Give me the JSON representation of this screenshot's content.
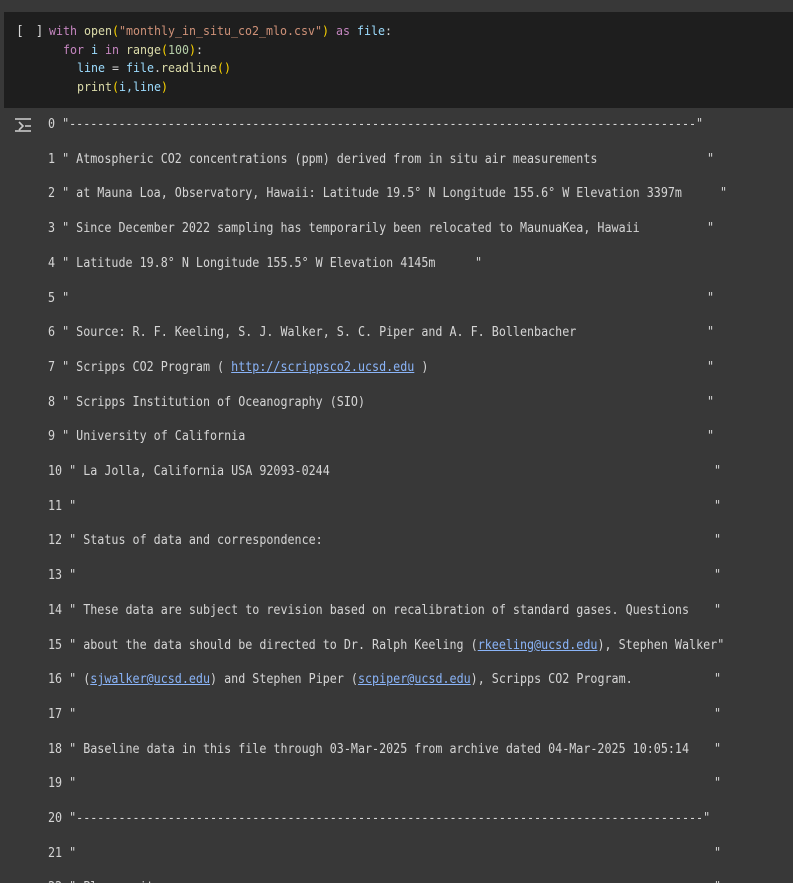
{
  "cell": {
    "run_label": "[ ]",
    "code": {
      "l1_kw1": "with",
      "l1_fn": "open",
      "l1_str": "\"monthly_in_situ_co2_mlo.csv\"",
      "l1_kw2": "as",
      "l1_var": "file",
      "l2_kw1": "for",
      "l2_var": "i",
      "l2_kw2": "in",
      "l2_fn": "range",
      "l2_num": "100",
      "l3_var1": "line",
      "l3_var2": "file",
      "l3_fn": "readline",
      "l4_fn": "print",
      "l4_args": "i,line"
    }
  },
  "output": {
    "icon": "output-toggle-icon",
    "lines": [
      {
        "n": "0",
        "text": "\"-----------------------------------------------------------------------------------------\""
      },
      {
        "n": "1",
        "text": "\" Atmospheric CO2 concentrations (ppm) derived from in situ air measurements",
        "end": "\""
      },
      {
        "n": "2",
        "text": "\" at Mauna Loa, Observatory, Hawaii: Latitude 19.5° N Longitude 155.6° W Elevation 3397m",
        "end": "\""
      },
      {
        "n": "3",
        "text": "\" Since December 2022 sampling has temporarily been relocated to MaunuaKea, Hawaii",
        "end": "\""
      },
      {
        "n": "4",
        "text": "\" Latitude 19.8° N Longitude 155.5° W Elevation 4145m",
        "end": "\""
      },
      {
        "n": "5",
        "text": "\"",
        "end": "\""
      },
      {
        "n": "6",
        "text": "\" Source: R. F. Keeling, S. J. Walker, S. C. Piper and A. F. Bollenbacher",
        "end": "\""
      },
      {
        "n": "7",
        "pre": "\" Scripps CO2 Program ( ",
        "link": "http://scrippsco2.ucsd.edu",
        "post": " )",
        "end": "\""
      },
      {
        "n": "8",
        "text": "\" Scripps Institution of Oceanography (SIO)",
        "end": "\""
      },
      {
        "n": "9",
        "text": "\" University of California",
        "end": "\""
      },
      {
        "n": "10",
        "text": "\" La Jolla, California USA 92093-0244",
        "end": "\""
      },
      {
        "n": "11",
        "text": "\"",
        "end": "\""
      },
      {
        "n": "12",
        "text": "\" Status of data and correspondence:",
        "end": "\""
      },
      {
        "n": "13",
        "text": "\"",
        "end": "\""
      },
      {
        "n": "14",
        "text": "\" These data are subject to revision based on recalibration of standard gases. Questions",
        "end": "\""
      },
      {
        "n": "15",
        "pre": "\" about the data should be directed to Dr. Ralph Keeling (",
        "link": "rkeeling@ucsd.edu",
        "post": "), Stephen Walker\""
      },
      {
        "n": "16",
        "pre": "\" (",
        "link": "sjwalker@ucsd.edu",
        "mid": ") and Stephen Piper (",
        "link2": "scpiper@ucsd.edu",
        "post": "), Scripps CO2 Program.",
        "end": "\""
      },
      {
        "n": "17",
        "text": "\"",
        "end": "\""
      },
      {
        "n": "18",
        "text": "\" Baseline data in this file through 03-Mar-2025 from archive dated 04-Mar-2025 10:05:14",
        "end": "\""
      },
      {
        "n": "19",
        "text": "\"",
        "end": "\""
      },
      {
        "n": "20",
        "text": "\"-----------------------------------------------------------------------------------------\""
      },
      {
        "n": "21",
        "text": "\"",
        "end": "\""
      },
      {
        "n": "22",
        "text": "\" Please cite as:",
        "end": "\""
      }
    ]
  }
}
